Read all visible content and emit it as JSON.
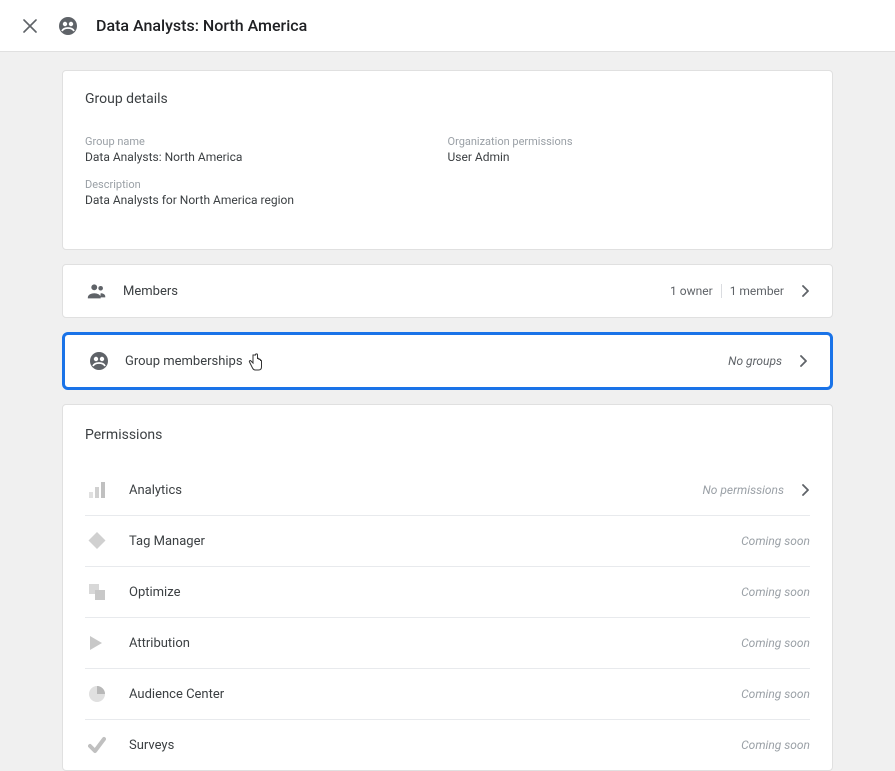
{
  "header": {
    "title": "Data Analysts: North America"
  },
  "details": {
    "section_title": "Group details",
    "group_name_label": "Group name",
    "group_name_value": "Data Analysts: North America",
    "org_perm_label": "Organization permissions",
    "org_perm_value": "User Admin",
    "description_label": "Description",
    "description_value": "Data Analysts for North America region"
  },
  "members": {
    "label": "Members",
    "owners": "1 owner",
    "members": "1 member"
  },
  "memberships": {
    "label": "Group memberships",
    "status": "No groups"
  },
  "permissions": {
    "title": "Permissions",
    "rows": [
      {
        "name": "Analytics",
        "status": "No permissions",
        "clickable": true
      },
      {
        "name": "Tag Manager",
        "status": "Coming soon",
        "clickable": false
      },
      {
        "name": "Optimize",
        "status": "Coming soon",
        "clickable": false
      },
      {
        "name": "Attribution",
        "status": "Coming soon",
        "clickable": false
      },
      {
        "name": "Audience Center",
        "status": "Coming soon",
        "clickable": false
      },
      {
        "name": "Surveys",
        "status": "Coming soon",
        "clickable": false
      }
    ]
  }
}
